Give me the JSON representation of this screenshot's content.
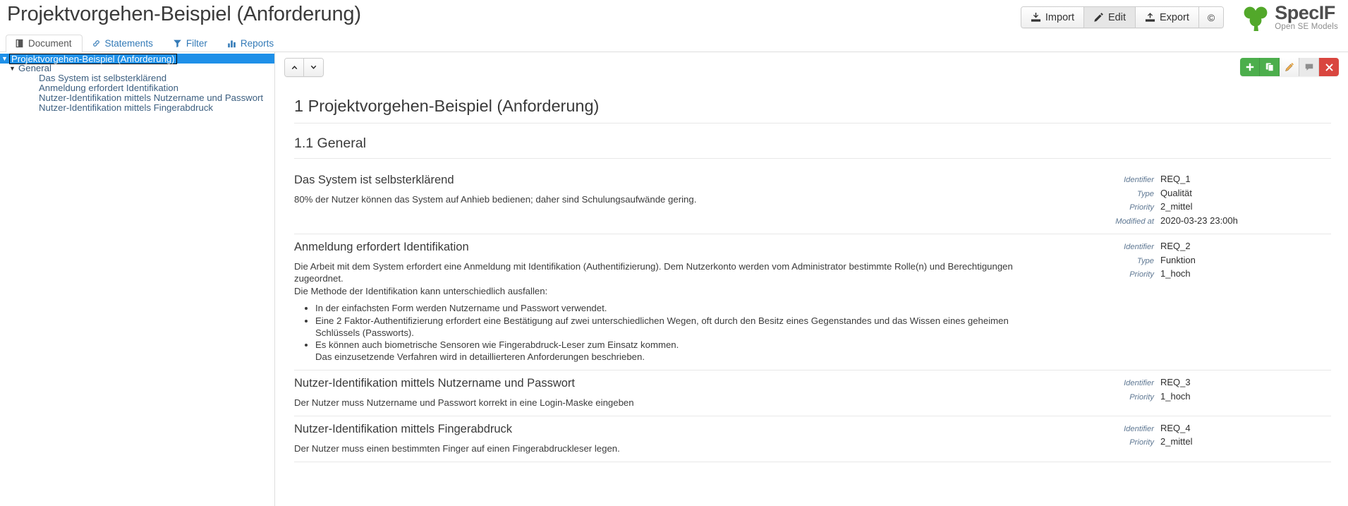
{
  "header": {
    "title": "Projektvorgehen-Beispiel (Anforderung)",
    "buttons": [
      {
        "label": "Import",
        "icon": "import-icon",
        "active": false
      },
      {
        "label": "Edit",
        "icon": "pencil-icon",
        "active": true
      },
      {
        "label": "Export",
        "icon": "export-icon",
        "active": false
      },
      {
        "label": "©",
        "icon": "copyright-icon",
        "active": false
      }
    ],
    "logo": {
      "name": "SpecIF",
      "tagline": "Open SE Models",
      "color": "#52a82a"
    }
  },
  "tabs": [
    {
      "label": "Document",
      "icon": "document-icon",
      "active": true
    },
    {
      "label": "Statements",
      "icon": "link-icon",
      "active": false
    },
    {
      "label": "Filter",
      "icon": "funnel-icon",
      "active": false
    },
    {
      "label": "Reports",
      "icon": "bar-chart-icon",
      "active": false
    }
  ],
  "sidebar": {
    "items": [
      {
        "label": "Projektvorgehen-Beispiel (Anforderung)",
        "level": 1,
        "twisty": "▼",
        "selected": true
      },
      {
        "label": "General",
        "level": 2,
        "twisty": "▼",
        "selected": false
      },
      {
        "label": "Das System ist selbsterklärend",
        "level": 3,
        "twisty": "",
        "selected": false
      },
      {
        "label": "Anmeldung erfordert Identifikation",
        "level": 3,
        "twisty": "",
        "selected": false
      },
      {
        "label": "Nutzer-Identifikation mittels Nutzername und Passwort",
        "level": 3,
        "twisty": "",
        "selected": false
      },
      {
        "label": "Nutzer-Identifikation mittels Fingerabdruck",
        "level": 3,
        "twisty": "",
        "selected": false
      }
    ]
  },
  "toolbar": {
    "nav": [
      {
        "name": "move-up-button",
        "icon": "chevron-up-icon"
      },
      {
        "name": "move-down-button",
        "icon": "chevron-down-icon"
      }
    ],
    "actions": [
      {
        "name": "add-button",
        "icon": "plus-icon",
        "style": "green"
      },
      {
        "name": "clone-button",
        "icon": "copy-icon",
        "style": "green"
      },
      {
        "name": "edit-button",
        "icon": "pencil-icon",
        "style": "white"
      },
      {
        "name": "comment-button",
        "icon": "comment-icon",
        "style": "gray"
      },
      {
        "name": "delete-button",
        "icon": "close-icon",
        "style": "red"
      }
    ]
  },
  "document": {
    "chapter": "1 Projektvorgehen-Beispiel (Anforderung)",
    "section": "1.1 General",
    "resources": [
      {
        "title": "Das System ist selbsterklärend",
        "paragraphs": [
          "80% der Nutzer können das System auf Anhieb bedienen; daher sind Schulungsaufwände gering."
        ],
        "bullets": [],
        "after_bullets": [],
        "properties": [
          {
            "label": "Identifier",
            "value": "REQ_1"
          },
          {
            "label": "Type",
            "value": "Qualität"
          },
          {
            "label": "Priority",
            "value": "2_mittel"
          },
          {
            "label": "Modified at",
            "value": "2020-03-23 23:00h"
          }
        ]
      },
      {
        "title": "Anmeldung erfordert Identifikation",
        "paragraphs": [
          "Die Arbeit mit dem System erfordert eine Anmeldung mit Identifikation (Authentifizierung). Dem Nutzerkonto werden vom Administrator bestimmte Rolle(n) und Berechtigungen zugeordnet.",
          "Die Methode der Identifikation kann unterschiedlich ausfallen:"
        ],
        "bullets": [
          "In der einfachsten Form werden Nutzername und Passwort verwendet.",
          "Eine 2 Faktor-Authentifizierung erfordert eine Bestätigung auf zwei unterschiedlichen Wegen, oft durch den Besitz eines Gegenstandes und das Wissen eines geheimen Schlüssels (Passworts).",
          "Es können auch biometrische Sensoren wie Fingerabdruck-Leser zum Einsatz kommen.\nDas einzusetzende Verfahren wird in detaillierteren Anforderungen beschrieben."
        ],
        "after_bullets": [],
        "properties": [
          {
            "label": "Identifier",
            "value": "REQ_2"
          },
          {
            "label": "Type",
            "value": "Funktion"
          },
          {
            "label": "Priority",
            "value": "1_hoch"
          }
        ]
      },
      {
        "title": "Nutzer-Identifikation mittels Nutzername und Passwort",
        "paragraphs": [
          "Der Nutzer muss Nutzername und Passwort korrekt in eine Login-Maske eingeben"
        ],
        "bullets": [],
        "after_bullets": [],
        "properties": [
          {
            "label": "Identifier",
            "value": "REQ_3"
          },
          {
            "label": "Priority",
            "value": "1_hoch"
          }
        ]
      },
      {
        "title": "Nutzer-Identifikation mittels Fingerabdruck",
        "paragraphs": [
          "Der Nutzer muss einen bestimmten Finger auf einen Fingerabdruckleser legen."
        ],
        "bullets": [],
        "after_bullets": [],
        "properties": [
          {
            "label": "Identifier",
            "value": "REQ_4"
          },
          {
            "label": "Priority",
            "value": "2_mittel"
          }
        ]
      }
    ]
  }
}
